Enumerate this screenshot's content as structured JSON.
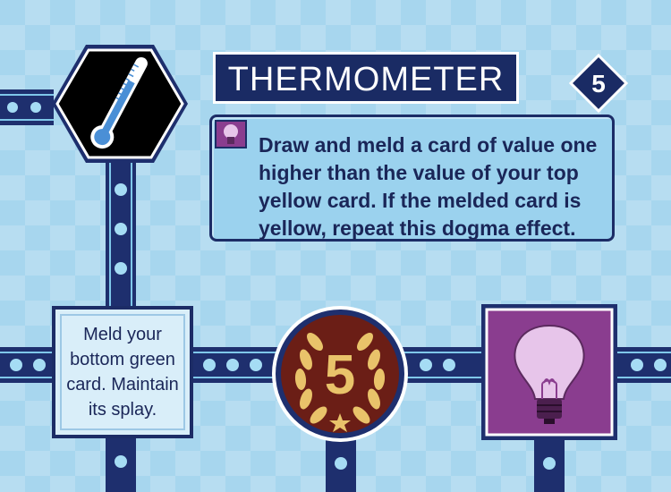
{
  "card": {
    "title": "THERMOMETER",
    "age": "5",
    "dogma_text": "Draw and meld a card of value one higher than the value of your top yellow card. If the melded card is yellow, repeat this dogma effect.",
    "echo_text": "Meld your bottom green card. Maintain its splay.",
    "medal_value": "5"
  },
  "icons": {
    "top_left": "thermometer-icon",
    "dogma_icon": "lightbulb-icon",
    "bottom_right": "lightbulb-icon",
    "center": "laurel-medal-icon"
  },
  "colors": {
    "navy": "#1e2f6e",
    "sky": "#a7d6ee",
    "purple": "#8a3d8f",
    "bronze": "#6b1e16",
    "gold": "#e9c36a"
  }
}
